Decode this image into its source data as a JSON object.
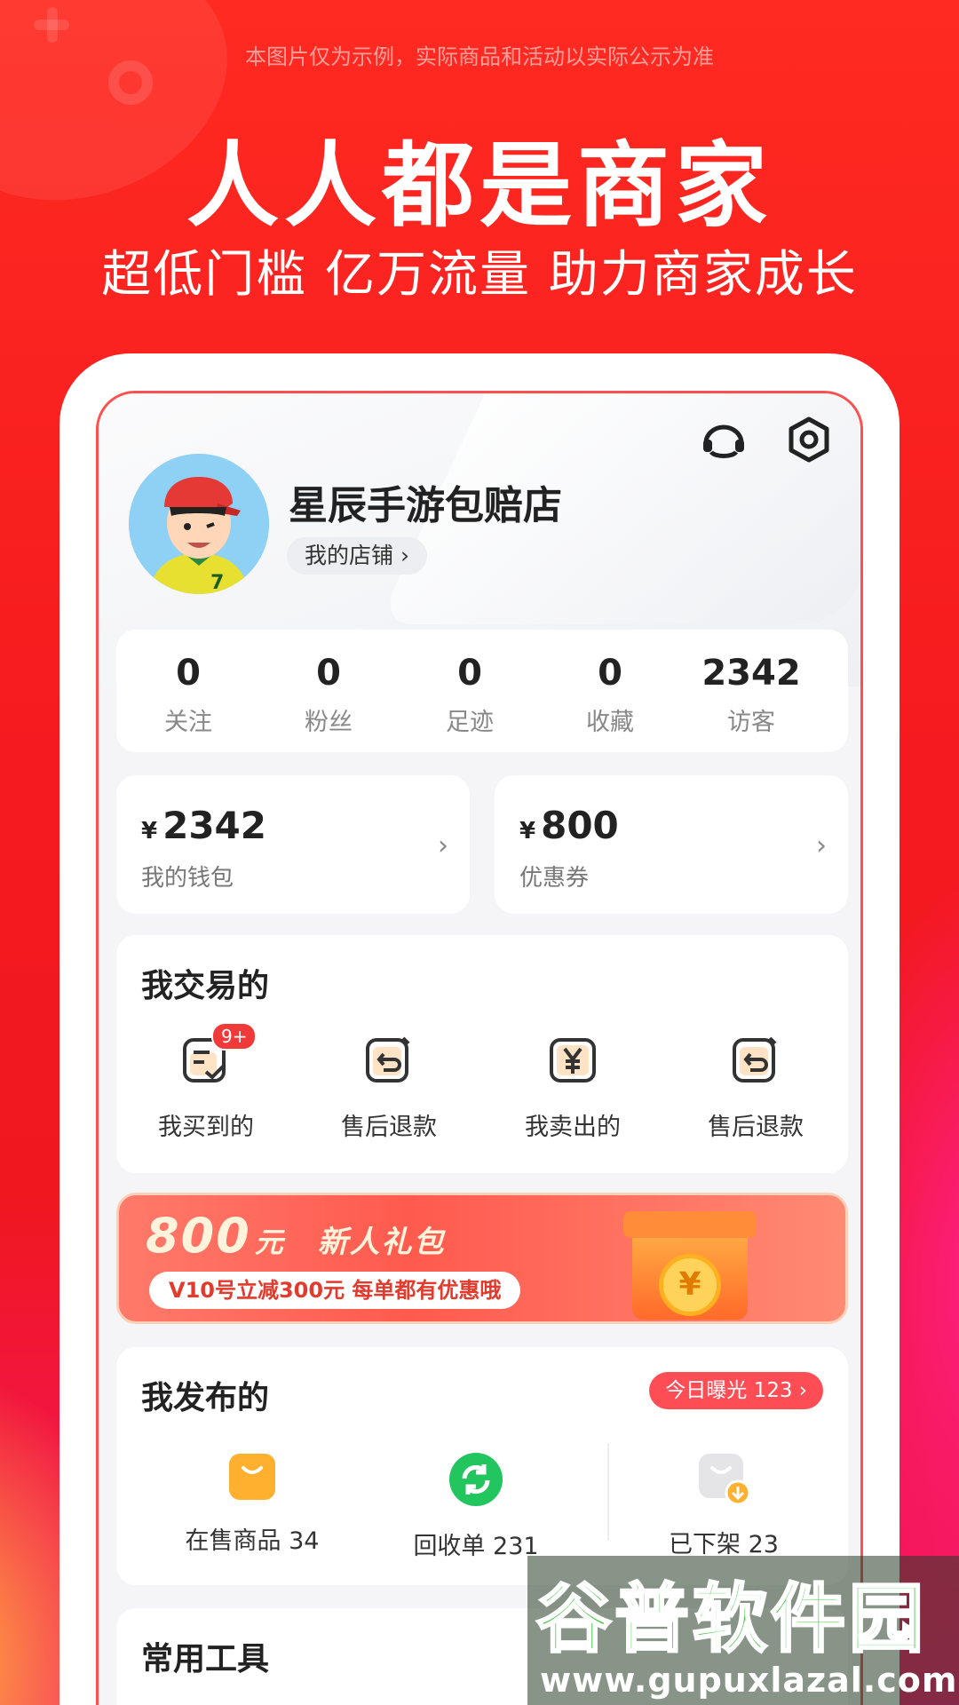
{
  "banner": {
    "disclaimer": "本图片仅为示例，实际商品和活动以实际公示为准",
    "headline": "人人都是商家",
    "subline": "超低门槛 亿万流量 助力商家成长"
  },
  "profile": {
    "shop_name": "星辰手游包赔店",
    "my_shop_label": "我的店铺 ›"
  },
  "stats": [
    {
      "value": "0",
      "label": "关注"
    },
    {
      "value": "0",
      "label": "粉丝"
    },
    {
      "value": "0",
      "label": "足迹"
    },
    {
      "value": "0",
      "label": "收藏"
    },
    {
      "value": "2342",
      "label": "访客"
    }
  ],
  "wallet": {
    "currency": "¥",
    "amount": "2342",
    "label": "我的钱包",
    "arrow": "›"
  },
  "coupon": {
    "currency": "¥",
    "amount": "800",
    "label": "优惠券",
    "arrow": "›"
  },
  "trades": {
    "title": "我交易的",
    "items": [
      {
        "label": "我买到的",
        "badge": "9+"
      },
      {
        "label": "售后退款"
      },
      {
        "label": "我卖出的"
      },
      {
        "label": "售后退款"
      }
    ]
  },
  "promo": {
    "big_number": "800",
    "big_unit": "元",
    "title": "新人礼包",
    "pill": "V10号立减300元 每单都有优惠哦",
    "coin": "¥"
  },
  "published": {
    "title": "我发布的",
    "today_label": "今日曝光 123 ›",
    "items": [
      {
        "label": "在售商品 34"
      },
      {
        "label": "回收单 231"
      },
      {
        "label": "已下架 23"
      }
    ]
  },
  "tools": {
    "title": "常用工具"
  },
  "watermark": {
    "name": "谷普软件园",
    "url": "www.gupuxlazal.com"
  },
  "colors": {
    "brand_red": "#f31c1c",
    "badge_red": "#f03a3a",
    "accent_orange": "#ffb02e",
    "recycle_green": "#22c55e"
  }
}
